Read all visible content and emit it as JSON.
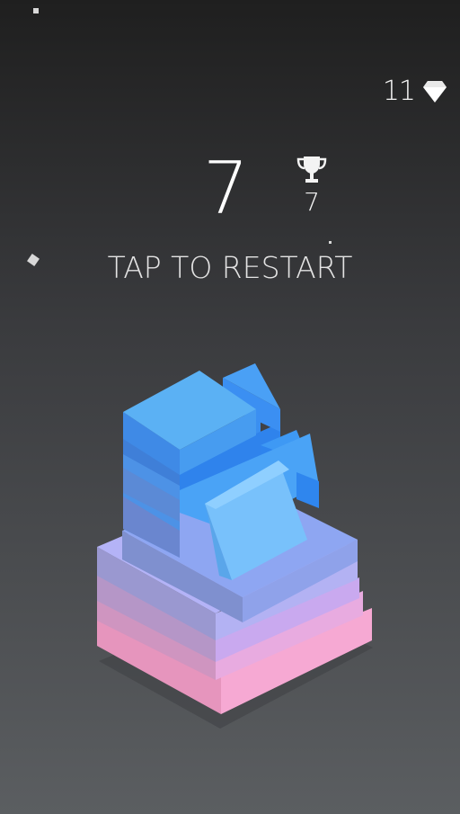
{
  "hud": {
    "gems": "11",
    "score": "7",
    "best": "7"
  },
  "prompt": {
    "restart_label": "TAP TO RESTART"
  },
  "icons": {
    "gem": "diamond-icon",
    "best": "trophy-icon"
  },
  "colors": {
    "background_top": "#1f1f1f",
    "background_bottom": "#5b5e61",
    "block_blue": "#4fa6ef",
    "block_violet": "#a8aaf2",
    "block_pink": "#f4a6cf"
  }
}
